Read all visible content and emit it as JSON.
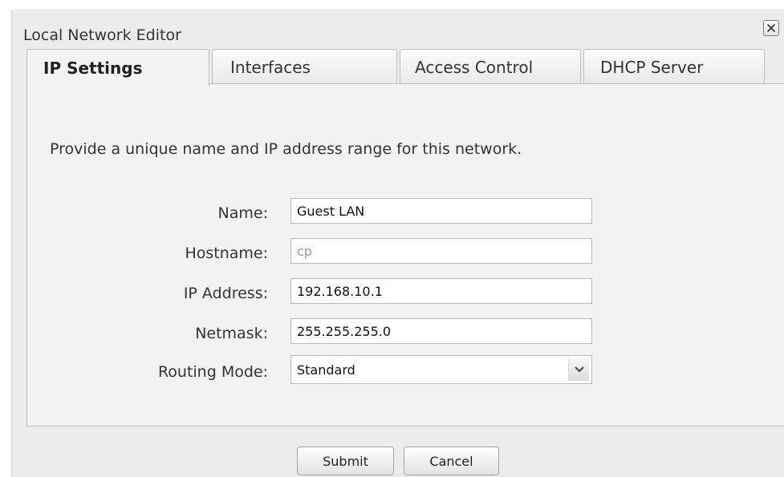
{
  "dialog": {
    "title": "Local Network Editor",
    "close_label": "Close"
  },
  "tabs": [
    {
      "label": "IP Settings",
      "active": true
    },
    {
      "label": "Interfaces",
      "active": false
    },
    {
      "label": "Access Control",
      "active": false
    },
    {
      "label": "DHCP Server",
      "active": false
    }
  ],
  "ip_settings": {
    "intro": "Provide a unique name and IP address range for this network.",
    "name": {
      "label": "Name:",
      "value": "Guest LAN"
    },
    "hostname": {
      "label": "Hostname:",
      "value": "",
      "placeholder": "cp"
    },
    "ip_address": {
      "label": "IP Address:",
      "value": "192.168.10.1"
    },
    "netmask": {
      "label": "Netmask:",
      "value": "255.255.255.0"
    },
    "routing_mode": {
      "label": "Routing Mode:",
      "selected": "Standard"
    }
  },
  "footer": {
    "submit_label": "Submit",
    "cancel_label": "Cancel"
  },
  "icons": {
    "close": "close-icon",
    "dropdown": "chevron-down-icon"
  },
  "colors": {
    "dialog_bg": "#ececec",
    "panel_bg": "#f2f2f2",
    "border": "#bdbdbd"
  }
}
